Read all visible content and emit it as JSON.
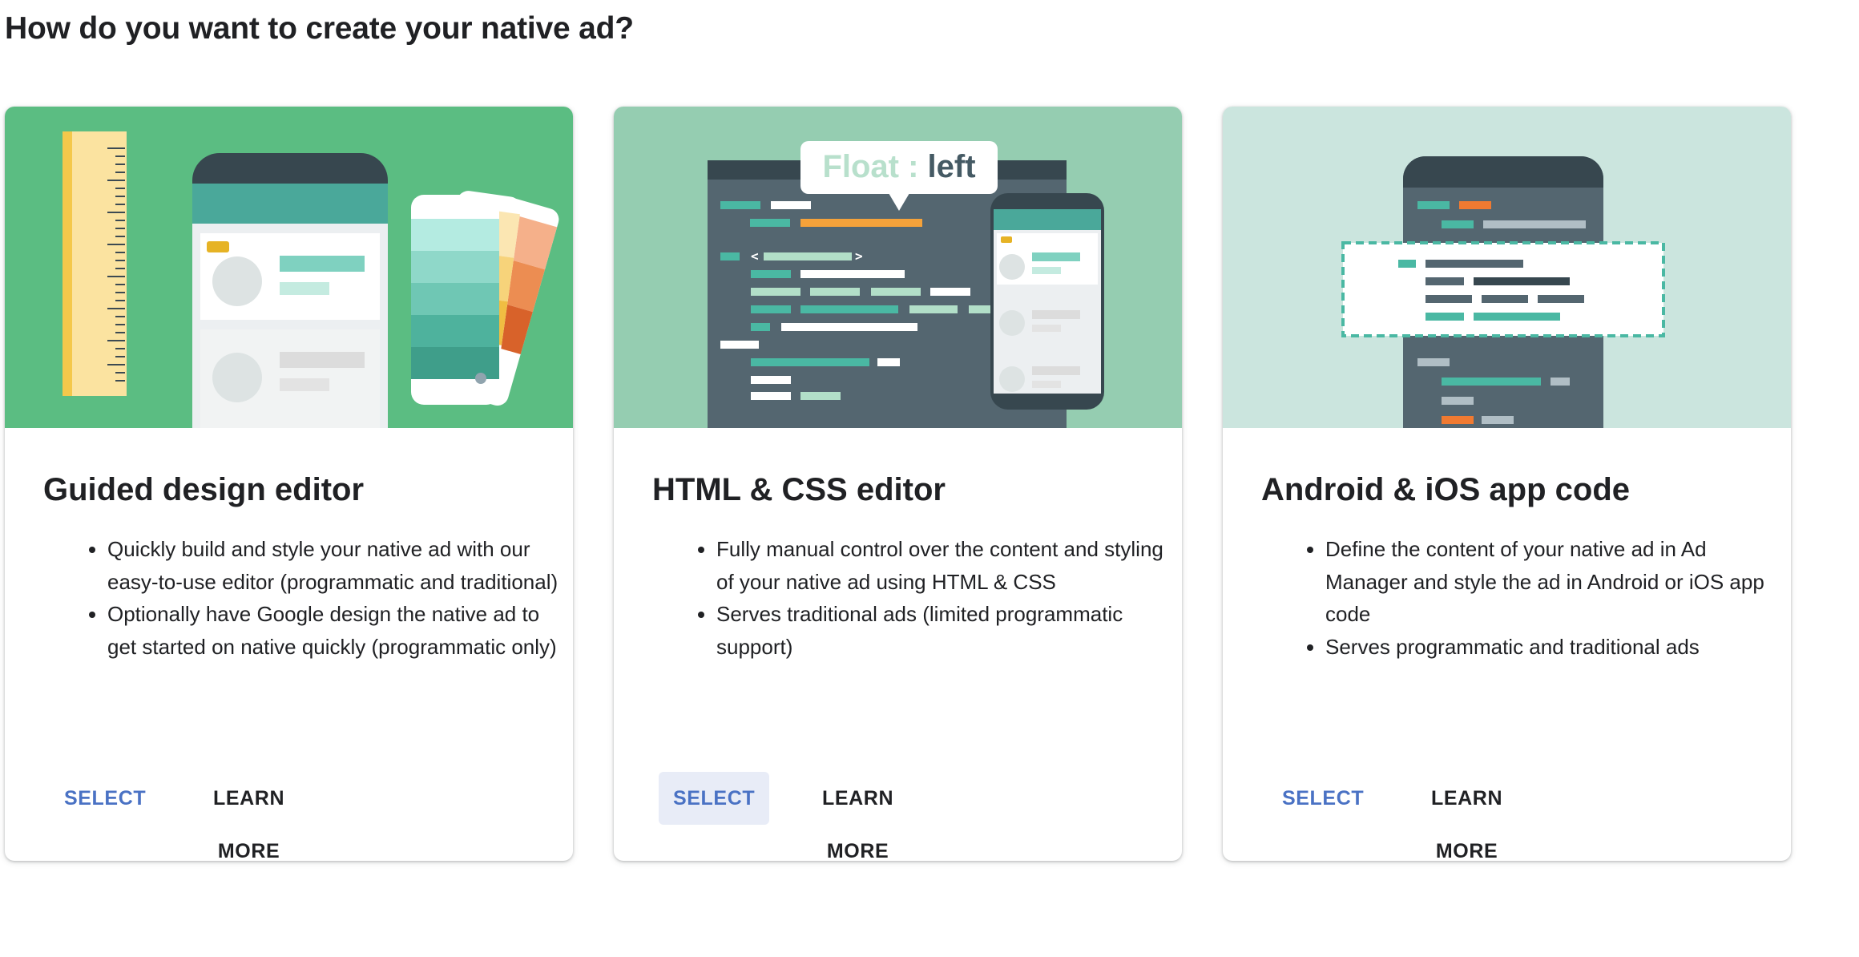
{
  "page": {
    "title": "How do you want to create your native ad?"
  },
  "cards": [
    {
      "title": "Guided design editor",
      "illustration": "design-editor-illustration",
      "bullets": [
        "Quickly build and style your native ad with our easy-to-use editor (programmatic and traditional)",
        "Optionally have Google design the native ad to get started on native quickly (programmatic only)"
      ],
      "select_label": "SELECT",
      "learn_more_label": "LEARN MORE"
    },
    {
      "title": "HTML & CSS editor",
      "illustration": "code-editor-illustration",
      "illustration_text": {
        "key": "Float : ",
        "value": "left"
      },
      "bullets": [
        "Fully manual control over the content and styling of your native ad using HTML & CSS",
        "Serves traditional ads (limited programmatic support)"
      ],
      "select_label": "SELECT",
      "learn_more_label": "LEARN MORE"
    },
    {
      "title": "Android & iOS app code",
      "illustration": "app-code-illustration",
      "bullets": [
        "Define the content of your native ad in Ad Manager and style the ad in Android or iOS app code",
        "Serves programmatic and traditional ads"
      ],
      "select_label": "SELECT",
      "learn_more_label": "LEARN MORE"
    }
  ],
  "colors": {
    "select_text": "#4a72c4",
    "select_active_bg": "#e8ecf7",
    "card1_bg": "#5bbd82",
    "card2_bg": "#95cdb1",
    "card3_bg": "#cbe5de"
  }
}
